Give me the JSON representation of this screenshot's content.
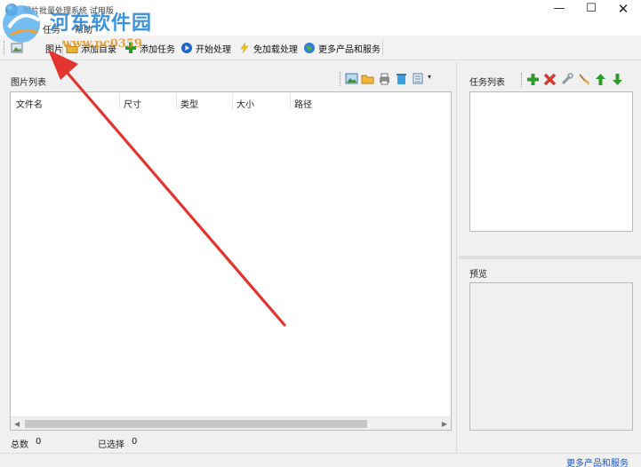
{
  "window": {
    "title": "图片批量处理系统 试用版",
    "minimize_glyph": "—",
    "maximize_glyph": "☐",
    "close_glyph": "✕"
  },
  "watermark": {
    "site_name": "河东软件园",
    "url_text": "www.pc0359"
  },
  "menu": {
    "items": [
      "任务",
      "帮助"
    ]
  },
  "toolbar": {
    "items": [
      {
        "label": "图片",
        "icon": "image-add-icon"
      },
      {
        "label": "添加目录",
        "icon": "folder-add-icon"
      },
      {
        "label": "添加任务",
        "icon": "plus-icon"
      },
      {
        "label": "开始处理",
        "icon": "play-icon"
      },
      {
        "label": "免加载处理",
        "icon": "lightning-icon"
      },
      {
        "label": "更多产品和服务",
        "icon": "globe-icon"
      }
    ]
  },
  "image_list": {
    "title": "图片列表",
    "columns": [
      "文件名",
      "尺寸",
      "类型",
      "大小",
      "路径"
    ],
    "rows": [],
    "toolbar_icons": [
      "landscape-icon",
      "folder-icon",
      "printer-icon",
      "trash-icon",
      "list-view-icon"
    ]
  },
  "status": {
    "total_label": "总数",
    "total_value": "0",
    "selected_label": "已选择",
    "selected_value": "0"
  },
  "task_list": {
    "title": "任务列表",
    "toolbar_icons": [
      "add-task-icon",
      "delete-task-icon",
      "wrench-icon",
      "broom-icon",
      "move-up-icon",
      "move-down-icon"
    ]
  },
  "preview": {
    "title": "预览"
  },
  "footer": {
    "more_link": "更多产品和服务"
  },
  "colors": {
    "arrow": "#e3342f",
    "link": "#1a55c8",
    "watermark_blue": "#2f8ad8",
    "watermark_orange": "#e2962c"
  }
}
